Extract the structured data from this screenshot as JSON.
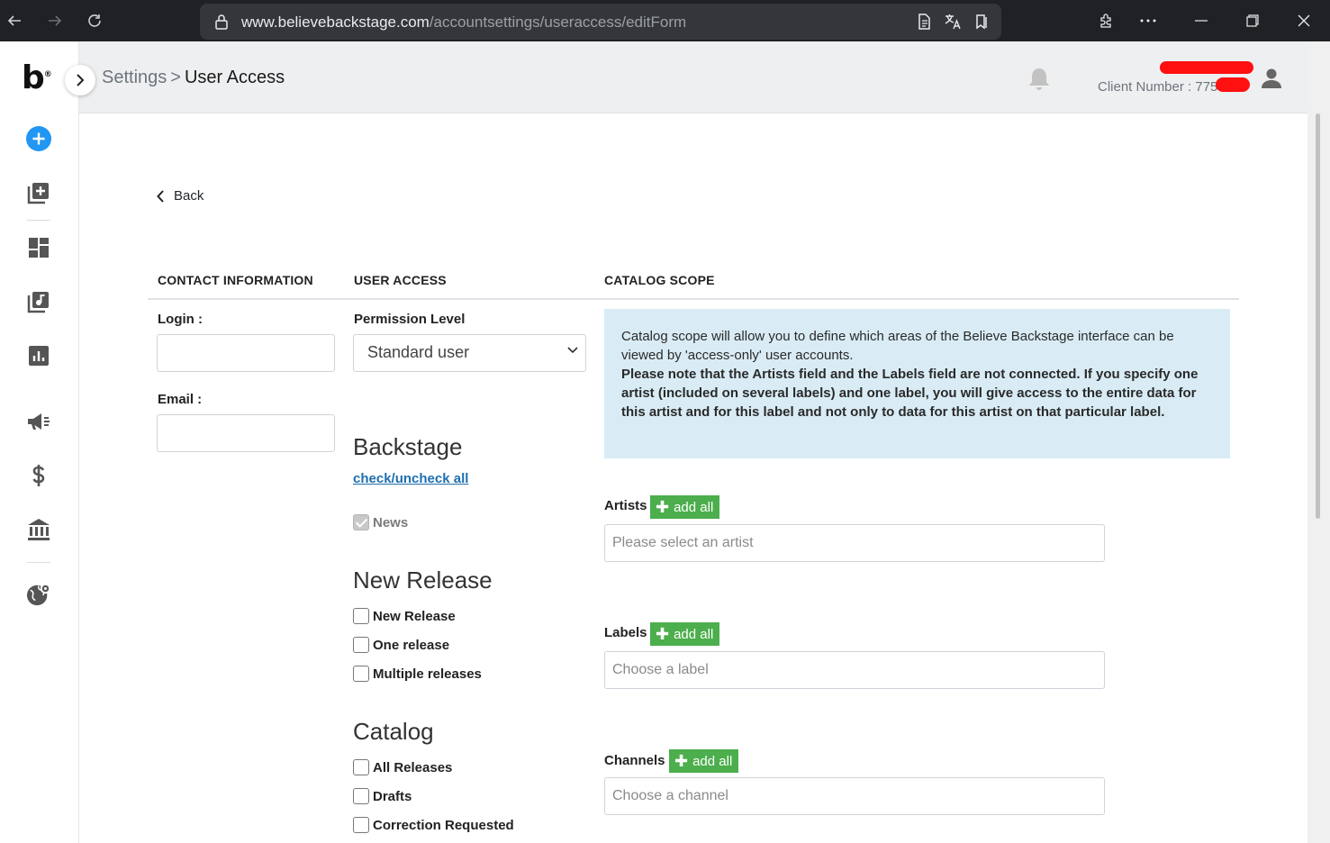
{
  "browser": {
    "url_host": "www.believebackstage.com",
    "url_path": "/accountsettings/useraccess/editForm"
  },
  "sidebar": {
    "logo": "b",
    "logo_mark": "®"
  },
  "header": {
    "breadcrumb_parent": "Settings",
    "breadcrumb_sep": ">",
    "breadcrumb_current": "User Access",
    "client_number": "Client Number : 775"
  },
  "main": {
    "back_label": "Back",
    "columns": {
      "contact": "CONTACT INFORMATION",
      "access": "USER ACCESS",
      "scope": "CATALOG SCOPE"
    },
    "contact": {
      "login_label": "Login :",
      "login_value": "",
      "email_label": "Email :",
      "email_value": ""
    },
    "access": {
      "permission_label": "Permission Level",
      "permission_value": "Standard user",
      "backstage_title": "Backstage",
      "toggle_all": "check/uncheck all",
      "news_label": "News",
      "new_release_title": "New Release",
      "new_release_items": [
        "New Release",
        "One release",
        "Multiple releases"
      ],
      "catalog_title": "Catalog",
      "catalog_items": [
        "All Releases",
        "Drafts",
        "Correction Requested"
      ]
    },
    "scope": {
      "info_text": "Catalog scope will allow you to define which areas of the Believe Backstage interface can be viewed by 'access-only' user accounts.",
      "info_bold": "Please note that the Artists field and the Labels field are not connected. If you specify one artist (included on several labels) and one label, you will give access to the entire data for this artist and for this label and not only to data for this artist on that particular label.",
      "artists_label": "Artists",
      "artists_placeholder": "Please select an artist",
      "labels_label": "Labels",
      "labels_placeholder": "Choose a label",
      "channels_label": "Channels",
      "channels_placeholder": "Choose a channel",
      "add_all": "add all"
    }
  },
  "colors": {
    "accent_blue": "#2196f3",
    "add_green": "#4cae4c",
    "info_bg": "#d9ecf5",
    "link_blue": "#1e6fb0"
  }
}
